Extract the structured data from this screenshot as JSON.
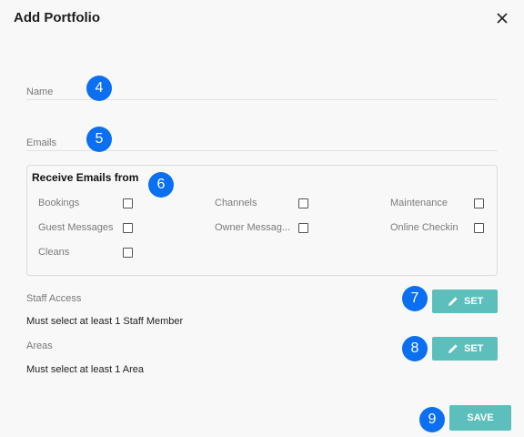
{
  "dialog": {
    "title": "Add Portfolio"
  },
  "form": {
    "name_label": "Name",
    "emails_label": "Emails"
  },
  "receive_emails": {
    "title": "Receive Emails from",
    "options": [
      {
        "label": "Bookings",
        "checked": false
      },
      {
        "label": "Channels",
        "checked": false
      },
      {
        "label": "Maintenance",
        "checked": false
      },
      {
        "label": "Guest Messages",
        "checked": false
      },
      {
        "label": "Owner Messag...",
        "checked": false
      },
      {
        "label": "Online Checkin",
        "checked": false
      },
      {
        "label": "Cleans",
        "checked": false
      }
    ]
  },
  "staff_access": {
    "label": "Staff Access",
    "value": "Must select at least 1 Staff Member",
    "button_label": "SET"
  },
  "areas": {
    "label": "Areas",
    "value": "Must select at least 1 Area",
    "button_label": "SET"
  },
  "footer": {
    "save_label": "SAVE"
  },
  "markers": [
    "4",
    "5",
    "6",
    "7",
    "8",
    "9"
  ],
  "colors": {
    "accent": "#5dbfbb",
    "marker": "#0b6ff2"
  },
  "icons": [
    "close-icon",
    "pencil-icon"
  ]
}
